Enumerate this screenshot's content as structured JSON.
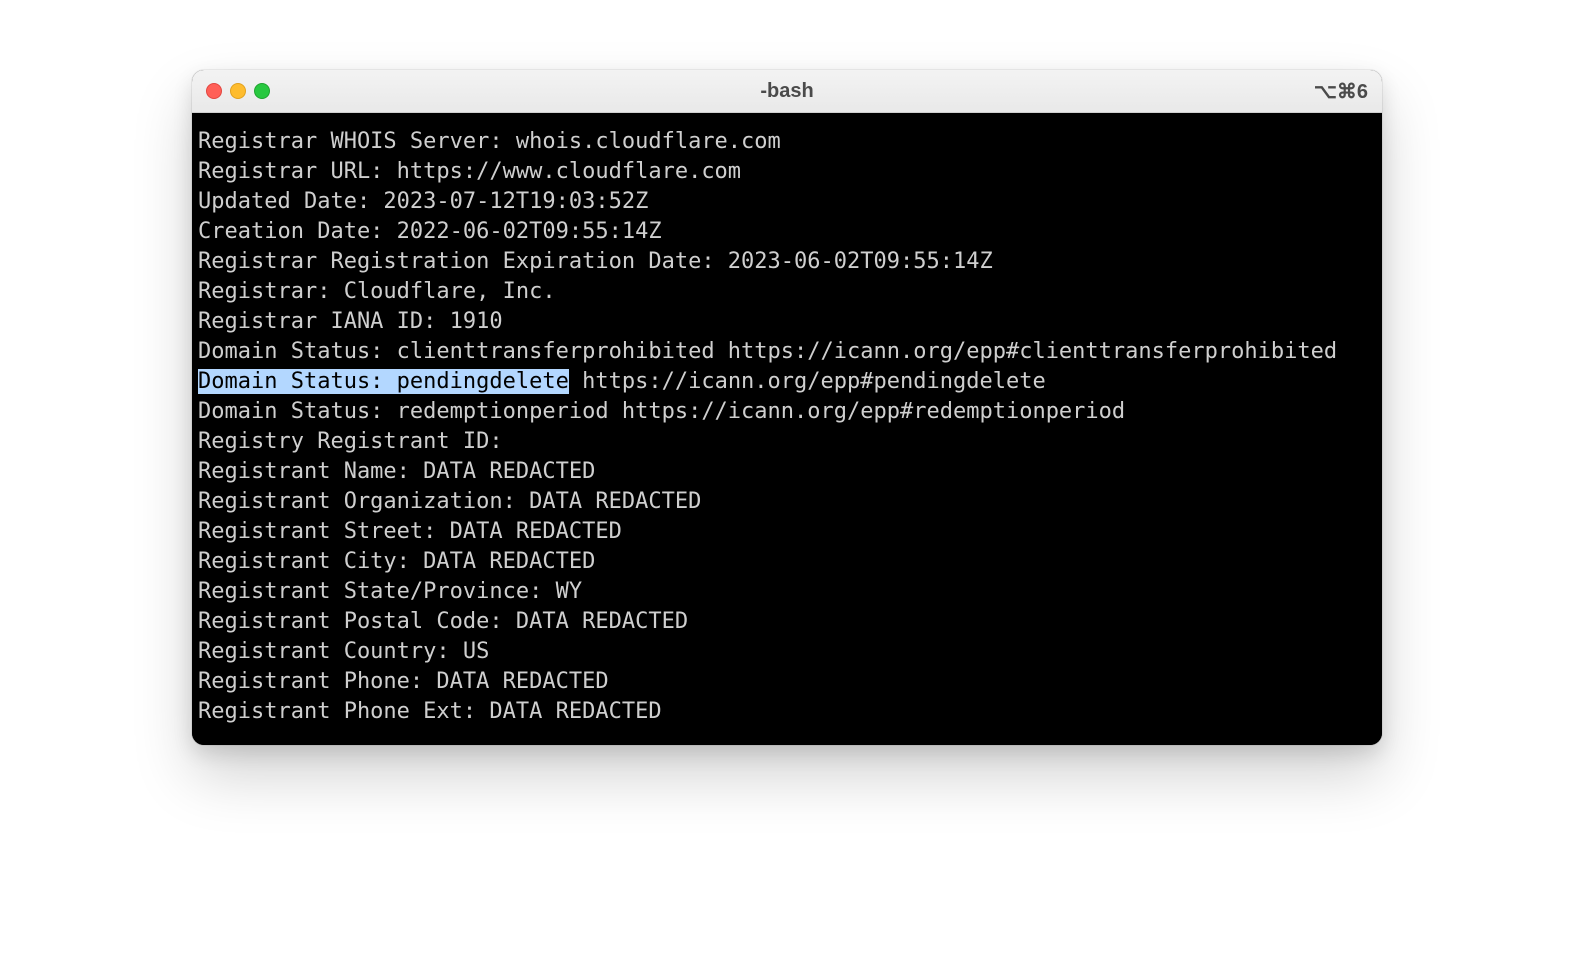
{
  "window": {
    "title": "-bash",
    "shortcut": "⌥⌘6"
  },
  "lines": {
    "l0": "Registrar WHOIS Server: whois.cloudflare.com",
    "l1": "Registrar URL: https://www.cloudflare.com",
    "l2": "Updated Date: 2023-07-12T19:03:52Z",
    "l3": "Creation Date: 2022-06-02T09:55:14Z",
    "l4": "Registrar Registration Expiration Date: 2023-06-02T09:55:14Z",
    "l5": "Registrar: Cloudflare, Inc.",
    "l6": "Registrar IANA ID: 1910",
    "l7": "Domain Status: clienttransferprohibited https://icann.org/epp#clienttransferprohibited",
    "l8a": "Domain Status: pendingdelete",
    "l8b": " https://icann.org/epp#pendingdelete",
    "l9": "Domain Status: redemptionperiod https://icann.org/epp#redemptionperiod",
    "l10": "Registry Registrant ID:",
    "l11": "Registrant Name: DATA REDACTED",
    "l12": "Registrant Organization: DATA REDACTED",
    "l13": "Registrant Street: DATA REDACTED",
    "l14": "Registrant City: DATA REDACTED",
    "l15": "Registrant State/Province: WY",
    "l16": "Registrant Postal Code: DATA REDACTED",
    "l17": "Registrant Country: US",
    "l18": "Registrant Phone: DATA REDACTED",
    "l19": "Registrant Phone Ext: DATA REDACTED"
  }
}
